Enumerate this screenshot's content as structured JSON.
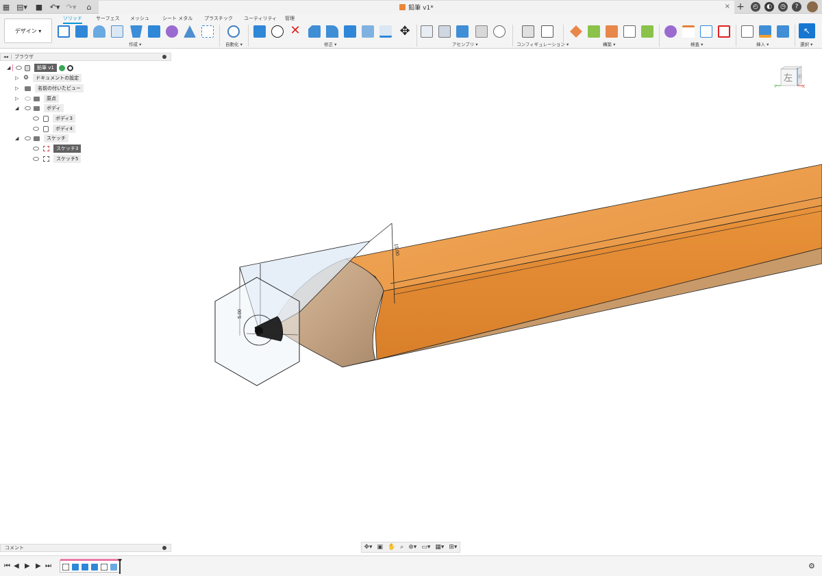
{
  "titlebar": {
    "doc_title": "鉛筆 v1*",
    "close_symbol": "×",
    "plus_symbol": "+"
  },
  "ribbon": {
    "workspace_label": "デザイン ▾",
    "tabs": [
      {
        "label": "ソリッド",
        "active": true
      },
      {
        "label": "サーフェス"
      },
      {
        "label": "メッシュ"
      },
      {
        "label": "シート メタル"
      },
      {
        "label": "プラスチック"
      },
      {
        "label": "ユーティリティ"
      },
      {
        "label": "管理"
      }
    ],
    "groups": [
      {
        "label": "作成 ▾"
      },
      {
        "label": "自動化 ▾"
      },
      {
        "label": "修正 ▾"
      },
      {
        "label": "アセンブリ ▾"
      },
      {
        "label": "コンフィギュレーション ▾"
      },
      {
        "label": "構築 ▾"
      },
      {
        "label": "検査 ▾"
      },
      {
        "label": "挿入 ▾"
      },
      {
        "label": "選択 ▾"
      }
    ]
  },
  "browser": {
    "title": "ブラウザ",
    "items": [
      {
        "label": "鉛筆 v1",
        "selected": true
      },
      {
        "label": "ドキュメントの設定"
      },
      {
        "label": "名前の付いたビュー"
      },
      {
        "label": "原点"
      },
      {
        "label": "ボディ"
      },
      {
        "label": "ボディ3"
      },
      {
        "label": "ボディ4"
      },
      {
        "label": "スケッチ"
      },
      {
        "label": "スケッチ3",
        "selected": true
      },
      {
        "label": "スケッチ5"
      }
    ]
  },
  "comment_bar": {
    "label": "コメント"
  },
  "viewcube": {
    "face_label": "左",
    "side_label": "前",
    "axis_y": "Y",
    "axis_x": "X"
  },
  "sketch": {
    "dim1": "5.00",
    "dim2": "15.00"
  },
  "colors": {
    "accent": "#0696d7",
    "wood_top": "#f0a24e",
    "wood_side": "#e08c36",
    "cone_wood": "#c4a484",
    "sketch_fill": "#dde9f5"
  }
}
